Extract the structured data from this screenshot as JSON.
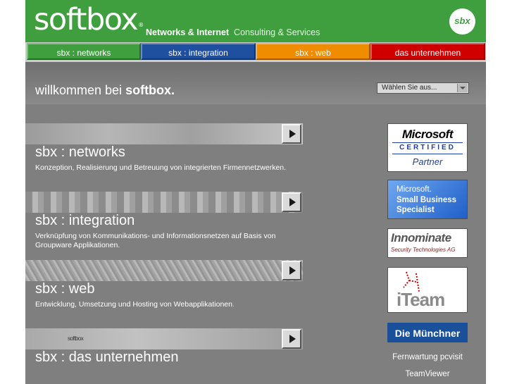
{
  "header": {
    "logo_text": "softbox",
    "logo_mark": "®",
    "tagline_bold": "Networks & Internet",
    "tagline_light": "Consulting & Services",
    "badge_text": "sbx"
  },
  "nav": {
    "tabs": [
      {
        "label": "sbx : networks",
        "color": "#3f9f3f"
      },
      {
        "label": "sbx : integration",
        "color": "#1f4f9f"
      },
      {
        "label": "sbx : web",
        "color": "#f08c00"
      },
      {
        "label": "das unternehmen",
        "color": "#d00000"
      }
    ]
  },
  "welcome": {
    "title_prefix": "willkommen bei",
    "title_brand": "softbox.",
    "select_value": "Wählen Sie aus..."
  },
  "sections": [
    {
      "title": "sbx : networks",
      "description": "Konzeption, Realisierung und Betreuung von integrierten Firmennetzwerken."
    },
    {
      "title": "sbx : integration",
      "description": "Verknüpfung von Kommunikations- und Informationsnetzen auf Basis von Groupware Applikationen."
    },
    {
      "title": "sbx : web",
      "description": "Entwicklung, Umsetzung und Hosting von Webapplikationen."
    },
    {
      "title": "sbx : das unternehmen",
      "description": "",
      "banner_text": "softbox"
    }
  ],
  "sidebar": {
    "ms_certified": {
      "brand": "Microsoft",
      "line": "CERTIFIED",
      "sub": "Partner"
    },
    "ms_sbs": {
      "line1": "Microsoft.",
      "line2": "Small Business",
      "line3": "Specialist"
    },
    "innominate": {
      "name": "Innominate",
      "sub": "Security Technologies AG"
    },
    "iteam": {
      "name": "iTeam"
    },
    "muenchner": {
      "name": "Die Münchner"
    },
    "links": [
      "Fernwartung pcvisit",
      "TeamViewer"
    ]
  }
}
